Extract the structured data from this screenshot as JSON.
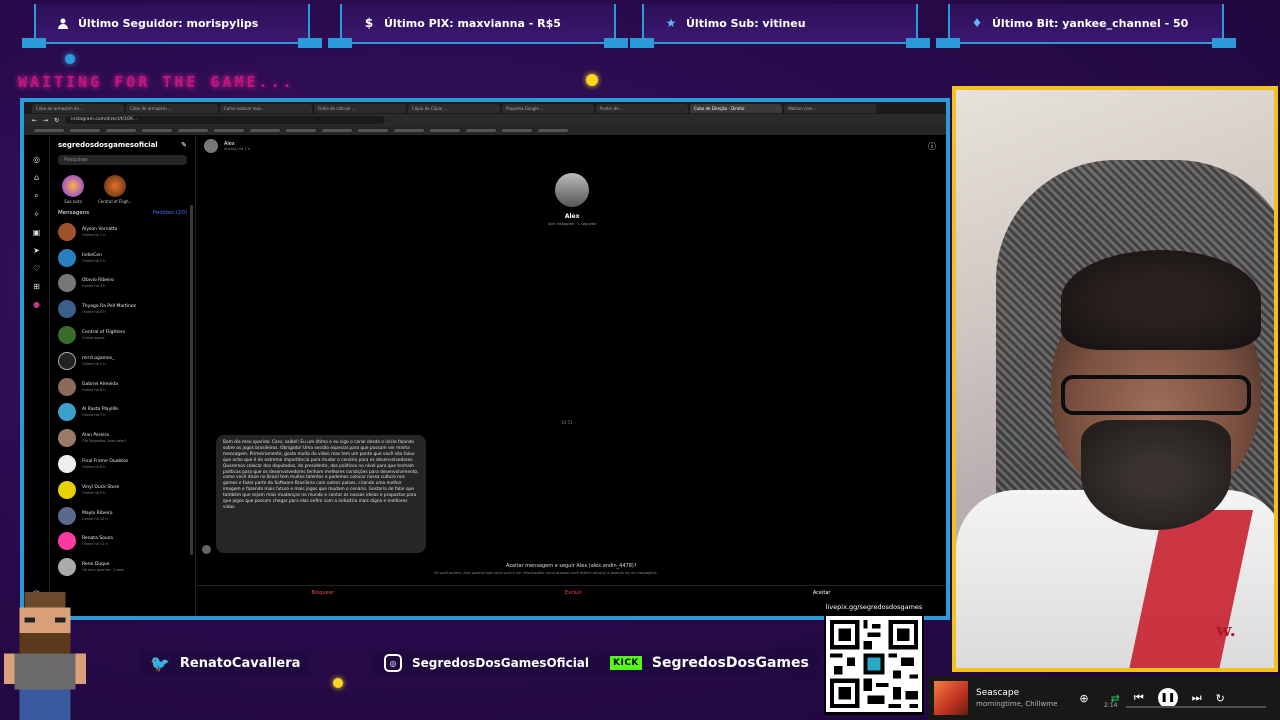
{
  "alerts": [
    {
      "icon": "user-icon",
      "text": "Último Seguidor: morispylips"
    },
    {
      "icon": "dollar-icon",
      "text": "Último PIX: maxvianna - R$5"
    },
    {
      "icon": "star-icon",
      "text": "Último Sub: vitineu"
    },
    {
      "icon": "diamond-icon",
      "text": "Último Bit: yankee_channel - 50"
    }
  ],
  "waiting_text": "WAITING FOR THE GAME...",
  "browser": {
    "tabs": [
      "Cobo de armazém do...",
      "Cobo de armazém ...",
      "Como colocar mas...",
      "Folha de cálculo ...",
      "Cópia de Cópia ...",
      "Proposta Google ...",
      "Poster de ...",
      "Cobo de Direção - Direito",
      "Watson com ..."
    ],
    "url": "instagram.com/direct/t/109...",
    "sidebar": {
      "handle": "segredosdosgamesoficial",
      "search_placeholder": "Pesquisar",
      "stories": [
        {
          "label": "Sua nota"
        },
        {
          "label": "Central of Fligh..."
        }
      ],
      "messages_label": "Mensagens",
      "requests_label": "Pedidos (20)",
      "conversations": [
        {
          "name": "Alyson Vornatto",
          "sub": "Online há 1 h"
        },
        {
          "name": "IndieCon",
          "sub": "Online há 2 h"
        },
        {
          "name": "Otavio Ribeiro",
          "sub": "Online há 3 h"
        },
        {
          "name": "Thyago Ra Pell Martinez",
          "sub": "Online há 4 h"
        },
        {
          "name": "Central of Flighters",
          "sub": "Online agora"
        },
        {
          "name": "mrrd.ogames_",
          "sub": "Online há 5 h"
        },
        {
          "name": "Gabriel Almeida",
          "sub": "Online há 6 h"
        },
        {
          "name": "Al Rasta Playlife",
          "sub": "Online há 7 h"
        },
        {
          "name": "Alan Pereira",
          "sub": "Olá Segredos, tudo bem?"
        },
        {
          "name": "Final Frame Ouabtos",
          "sub": "Online há 8 h"
        },
        {
          "name": "Vinyl Duck Store",
          "sub": "Online há 9 h"
        },
        {
          "name": "Mayla Ribeiro",
          "sub": "Online há 10 h"
        },
        {
          "name": "Renata Souza",
          "sub": "Online há 11 h"
        },
        {
          "name": "Rene Duque",
          "sub": "Ok meu querido · 2 sem"
        }
      ]
    },
    "chat": {
      "contact_name": "Alex",
      "contact_status": "Ativo(a) há 1 h",
      "profile_name": "Alex",
      "profile_sub": "Alex Instagram · 1 seguidor",
      "date_separator": "10:51",
      "message": "Bom dia meu querido. Caro, saibel! Eu um ótimo e eu sigo o canal desde o início falando sobre os jogos brasileiros. Obrigado! Uma sessão especial para que possam ver minha mensagem. Primeiramente, gosto muito do vídeo mas tem um ponto que você não falou que acho que é de extrema importância para mudar o cenário para os desenvolvedores. Queremos colocar dos deputados, do presidente, dos políticos no nível para que tenham políticas para que os desenvolvedores tenham melhores condições para desenvolvimento, como você disse no Brasil tem muitos talentos e podemos colocar nossa cultura nos games e fazer parte do Software Brasileiro com outros países, criando uma melhor imagem e fazendo mais futuro e mais jogos que mudam o cenário. Gostaria de falar que também que sejam mais mudanças no mundo e contar as nossas ideias e propostas para que jogos que possam chegar para elas enfim com a indústria mais digna e melhores vidas.",
      "request_title": "Aceitar mensagem e seguir Alex (alex.andin_4478)?",
      "request_sub": "Se você aceitar, Alex poderá ligar para você e ver informações como quando você esteve ativo(a) e quando leu as mensagens.",
      "actions": [
        "Bloquear",
        "Excluir",
        "Aceitar"
      ]
    }
  },
  "social": [
    {
      "badge": "twitter-icon",
      "label": "RenatoCavallera"
    },
    {
      "badge": "instagram-icon",
      "label": "SegredosDosGamesOficial"
    },
    {
      "badge": "KICK",
      "label": "SegredosDosGames"
    }
  ],
  "qr": {
    "url": "livepix.gg/segredosdosgames"
  },
  "player": {
    "title": "Seascape",
    "artist": "morningtime, Chillwme",
    "time": "2:14",
    "progress": 0.0
  },
  "colors": {
    "border": "#2a9bd8",
    "webcam_border": "#f2c21b",
    "waiting": "#c0157a",
    "kick": "#53fc18"
  }
}
